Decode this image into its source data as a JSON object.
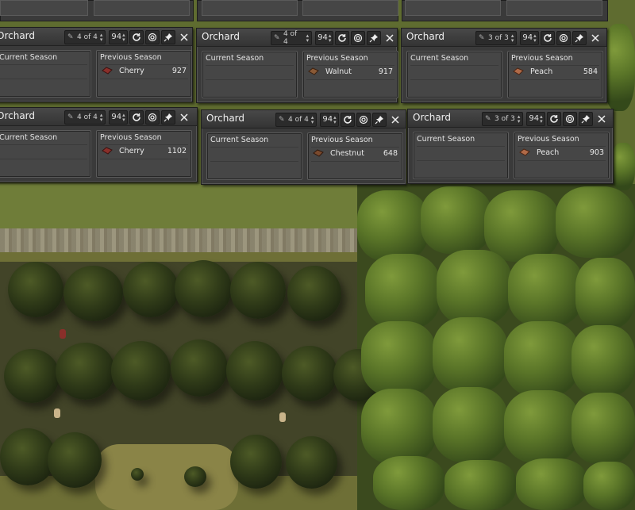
{
  "panels": [
    {
      "title": "Orchard",
      "workers": "4 of 4",
      "priority": "94",
      "current_season_label": "Current Season",
      "previous_season_label": "Previous Season",
      "crop": "Cherry",
      "crop_count": "927",
      "crop_color": "#8a2f2a"
    },
    {
      "title": "Orchard",
      "workers": "4 of 4",
      "priority": "94",
      "current_season_label": "Current Season",
      "previous_season_label": "Previous Season",
      "crop": "Walnut",
      "crop_count": "917",
      "crop_color": "#8a5a36"
    },
    {
      "title": "Orchard",
      "workers": "3 of 3",
      "priority": "94",
      "current_season_label": "Current Season",
      "previous_season_label": "Previous Season",
      "crop": "Peach",
      "crop_count": "584",
      "crop_color": "#b06a48"
    },
    {
      "title": "Orchard",
      "workers": "4 of 4",
      "priority": "94",
      "current_season_label": "Current Season",
      "previous_season_label": "Previous Season",
      "crop": "Cherry",
      "crop_count": "1102",
      "crop_color": "#8a2f2a"
    },
    {
      "title": "Orchard",
      "workers": "4 of 4",
      "priority": "94",
      "current_season_label": "Current Season",
      "previous_season_label": "Previous Season",
      "crop": "Chestnut",
      "crop_count": "648",
      "crop_color": "#7a4a2e"
    },
    {
      "title": "Orchard",
      "workers": "3 of 3",
      "priority": "94",
      "current_season_label": "Current Season",
      "previous_season_label": "Previous Season",
      "crop": "Peach",
      "crop_count": "903",
      "crop_color": "#b06a48"
    }
  ],
  "icons": {
    "worker": "hammer-icon",
    "refresh": "refresh-icon",
    "target": "target-icon",
    "pin": "pin-icon",
    "close": "close-icon"
  },
  "colors": {
    "panel_bg": "#3a3a3a",
    "grass": "#6b7a38",
    "forest": "#5a7528"
  }
}
